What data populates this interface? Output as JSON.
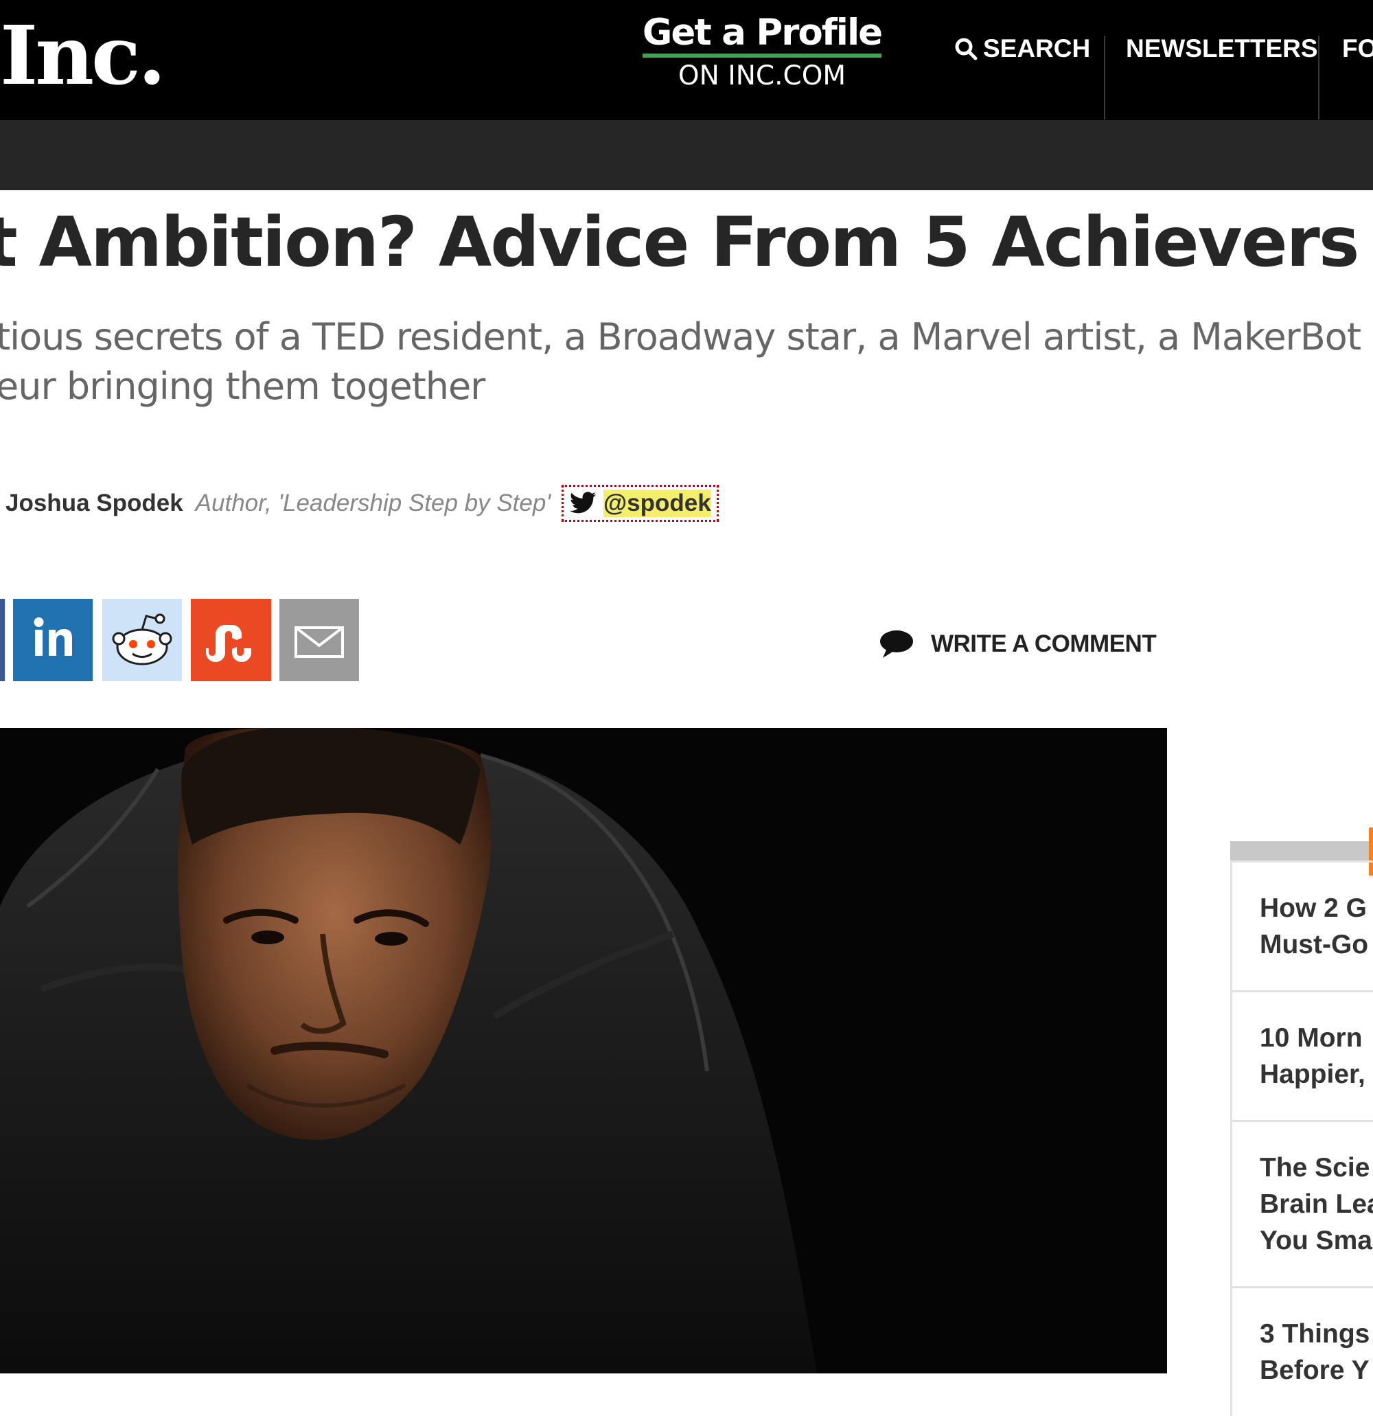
{
  "header": {
    "logo": "Inc.",
    "promo_main": "Get a Profile",
    "promo_sub": "ON INC.COM",
    "nav_search": "SEARCH",
    "nav_newsletters": "NEWSLETTERS",
    "nav_partial": "FO"
  },
  "article": {
    "headline": "t Ambition? Advice From 5 Achievers",
    "dek_line1": "tious secrets of a TED resident, a Broadway star, a Marvel artist, a MakerBot ex",
    "dek_line2": "eur bringing them together",
    "author": "Joshua Spodek",
    "author_title": "Author, 'Leadership Step by Step'",
    "twitter_handle": "@spodek",
    "comment_label": "WRITE A COMMENT"
  },
  "share_buttons": [
    {
      "name": "facebook",
      "icon": "facebook-icon",
      "color": "#3b5998"
    },
    {
      "name": "linkedin",
      "icon": "linkedin-icon",
      "color": "#1f71b0"
    },
    {
      "name": "reddit",
      "icon": "reddit-icon",
      "color": "#cee3f8"
    },
    {
      "name": "stumbleupon",
      "icon": "stumbleupon-icon",
      "color": "#eb4924"
    },
    {
      "name": "email",
      "icon": "email-icon",
      "color": "#9b9b9b"
    }
  ],
  "sidebar": {
    "items": [
      {
        "line1": "How 2 G",
        "line2": "Must-Go"
      },
      {
        "line1": "10 Morn",
        "line2": "Happier,"
      },
      {
        "line1": "The Scie",
        "line2": "Brain Lea",
        "line3": "You Sma"
      },
      {
        "line1": "3 Things",
        "line2": "Before Y"
      }
    ]
  },
  "colors": {
    "header_bg": "#000000",
    "subbar_bg": "#262626",
    "promo_underline": "#3fa34d",
    "twitter_highlight": "#f3ee6b",
    "sidebar_accent": "#f58220"
  }
}
